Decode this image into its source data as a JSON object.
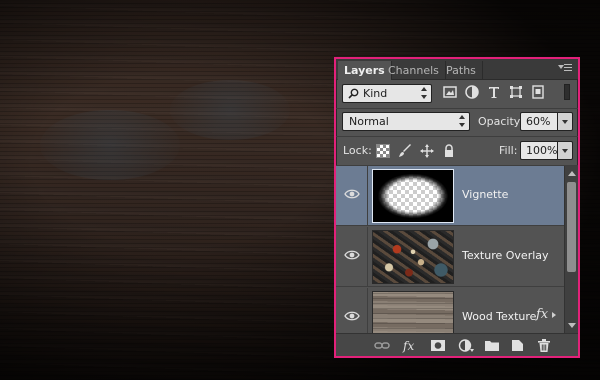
{
  "panel": {
    "tabs": [
      {
        "label": "Layers",
        "active": true
      },
      {
        "label": "Channels",
        "active": false
      },
      {
        "label": "Paths",
        "active": false
      }
    ],
    "filter": {
      "kind_label": "Kind",
      "icons": [
        "pixel-filter-icon",
        "adjustment-filter-icon",
        "type-filter-icon",
        "shape-filter-icon",
        "smart-object-filter-icon"
      ]
    },
    "blend_mode": "Normal",
    "opacity_label": "Opacity:",
    "opacity_value": "60%",
    "lock_label": "Lock:",
    "fill_label": "Fill:",
    "fill_value": "100%",
    "lock_icons": [
      "lock-transparent-pixels-icon",
      "lock-image-pixels-icon",
      "lock-position-icon",
      "lock-all-icon"
    ],
    "layers": [
      {
        "name": "Vignette",
        "selected": true,
        "visible": true,
        "has_fx": false
      },
      {
        "name": "Texture Overlay",
        "selected": false,
        "visible": true,
        "has_fx": false
      },
      {
        "name": "Wood Texture",
        "selected": false,
        "visible": true,
        "has_fx": true
      }
    ],
    "fx_symbol": "fx",
    "bottom_icons": [
      "link-layers-icon",
      "add-layer-style-icon",
      "add-mask-icon",
      "new-adjustment-layer-icon",
      "new-group-icon",
      "new-layer-icon",
      "delete-layer-icon"
    ]
  },
  "colors": {
    "highlight_border": "#e2217a",
    "selected_layer": "#6c7c93",
    "panel_bg": "#535353"
  }
}
